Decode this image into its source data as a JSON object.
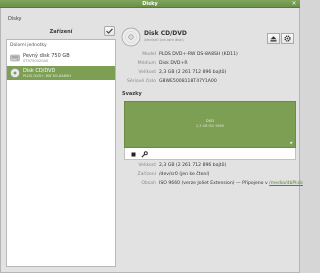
{
  "window": {
    "title": "Disky"
  },
  "menu": {
    "disks_label": "Disky"
  },
  "left": {
    "heading": "Zařízení",
    "group_label": "Dolomí jednotky",
    "devices": [
      {
        "name": "Pevný disk 750 GB",
        "sub": "ST9750420AS"
      },
      {
        "name": "Disk CD/DVD",
        "sub": "PLDS DVD+-RW DS-8A8SH"
      }
    ]
  },
  "detail": {
    "title": "Disk CD/DVD",
    "subtitle": "/dev/sr0 (cd-rom disk)",
    "rows": [
      {
        "key": "Model",
        "value": "PLDS DVD+-RW DS-8A8SH (KD11)"
      },
      {
        "key": "Médium",
        "value": "Disk DVD+R"
      },
      {
        "key": "Velikost",
        "value": "2,3 GB (2 261 712 896 bajtů)"
      },
      {
        "key": "Sériové číslo",
        "value": "G8WE5008118T47Y1A00"
      }
    ]
  },
  "volumes": {
    "title": "Svazky",
    "map_label": "DVD",
    "map_size": "2,3 GB ISO 9660",
    "rows": [
      {
        "key": "Velikost",
        "value": "2,3 GB (2 261 712 896 bajtů)"
      },
      {
        "key": "Zařízení",
        "value": "/dev/sr0 (jen ke čtení)"
      },
      {
        "key": "Obsah",
        "value": "ISO 9660 (verze Joliet Extension) — Připojeno v ",
        "link": "/media/dbPlick"
      }
    ]
  },
  "colors": {
    "accent": "#7d9f54",
    "titlebar": "#6f9a4b"
  },
  "icons": {
    "close": "close-icon",
    "check": "check-icon",
    "eject": "eject-icon",
    "gear": "gear-icon",
    "stop": "stop-icon",
    "wrench": "wrench-icon"
  }
}
